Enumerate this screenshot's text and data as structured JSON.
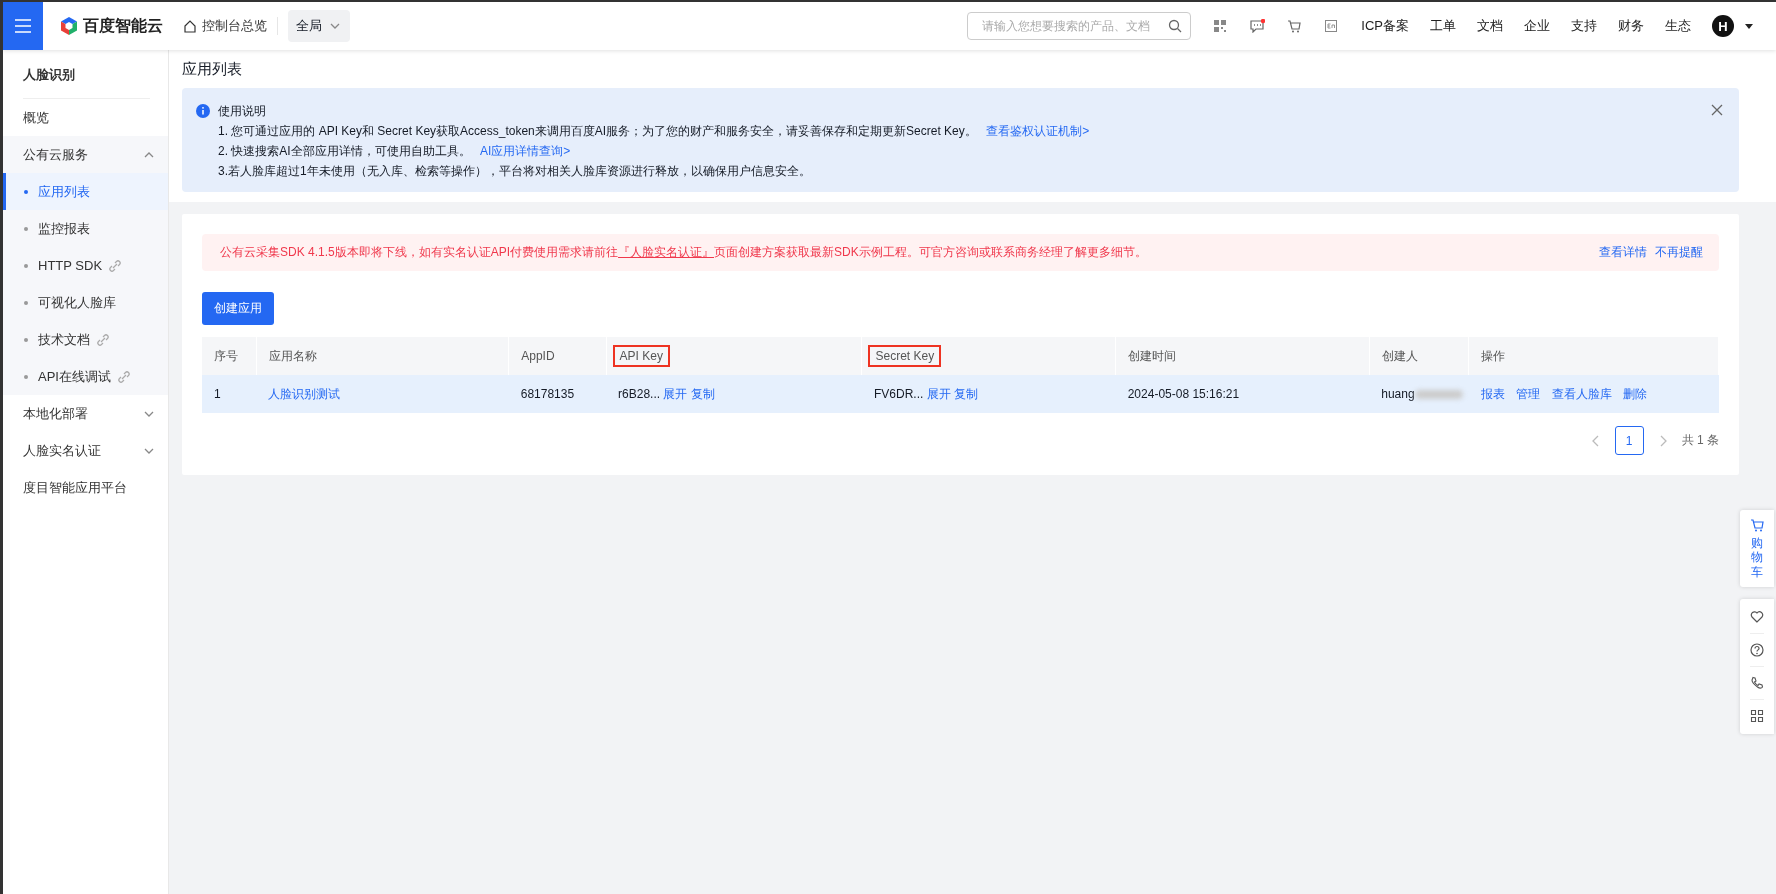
{
  "topbar": {
    "logo": "百度智能云",
    "home": "控制台总览",
    "region": "全局",
    "search": {
      "placeholder": "请输入您想要搜索的产品、文档"
    },
    "message_unread": true,
    "links": [
      "ICP备案",
      "工单",
      "文档",
      "企业",
      "支持",
      "财务",
      "生态"
    ],
    "avatar": "H"
  },
  "sidebar": {
    "title": "人脸识别",
    "items": [
      {
        "kind": "item",
        "label": "概览"
      },
      {
        "kind": "group",
        "label": "公有云服务",
        "expanded": true,
        "children": [
          {
            "label": "应用列表",
            "selected": true,
            "external": false
          },
          {
            "label": "监控报表",
            "selected": false,
            "external": false
          },
          {
            "label": "HTTP SDK",
            "selected": false,
            "external": true
          },
          {
            "label": "可视化人脸库",
            "selected": false,
            "external": false
          },
          {
            "label": "技术文档",
            "selected": false,
            "external": true
          },
          {
            "label": "API在线调试",
            "selected": false,
            "external": true
          }
        ]
      },
      {
        "kind": "group",
        "label": "本地化部署",
        "expanded": false
      },
      {
        "kind": "group",
        "label": "人脸实名认证",
        "expanded": false
      },
      {
        "kind": "item",
        "label": "度目智能应用平台"
      }
    ]
  },
  "page_title": "应用列表",
  "info": {
    "title": "使用说明",
    "lines": [
      {
        "text": "1. 您可通过应用的 API Key和 Secret Key获取Access_token来调用百度AI服务；为了您的财产和服务安全，请妥善保存和定期更新Secret Key。",
        "link": "查看鉴权认证机制>"
      },
      {
        "text": "2. 快速搜索AI全部应用详情，可使用自助工具。",
        "link": "AI应用详情查询>"
      },
      {
        "text": "3.若人脸库超过1年未使用（无入库、检索等操作），平台将对相关人脸库资源进行释放，以确保用户信息安全。"
      }
    ]
  },
  "notice": {
    "before": "公有云采集SDK 4.1.5版本即将下线，如有实名认证API付费使用需求请前往",
    "link": "『人脸实名认证』",
    "after": "页面创建方案获取最新SDK示例工程。可官方咨询或联系商务经理了解更多细节。",
    "actions": [
      "查看详情",
      "不再提醒"
    ]
  },
  "create_button": "创建应用",
  "table": {
    "columns": [
      {
        "label": "序号",
        "highlighted": false
      },
      {
        "label": "应用名称",
        "highlighted": false
      },
      {
        "label": "AppID",
        "highlighted": false
      },
      {
        "label": "API Key",
        "highlighted": true
      },
      {
        "label": "Secret Key",
        "highlighted": true
      },
      {
        "label": "创建时间",
        "highlighted": false
      },
      {
        "label": "创建人",
        "highlighted": false
      },
      {
        "label": "操作",
        "highlighted": false
      }
    ],
    "rows": [
      {
        "index": "1",
        "name": "人脸识别测试",
        "app_id": "68178135",
        "api_key": {
          "value": "r6B28...",
          "actions": [
            "展开",
            "复制"
          ]
        },
        "secret_key": {
          "value": "FV6DR...",
          "actions": [
            "展开",
            "复制"
          ]
        },
        "created": "2024-05-08 15:16:21",
        "creator": "huang",
        "creator_blurred": true,
        "actions": [
          "报表",
          "管理",
          "查看人脸库",
          "删除"
        ]
      }
    ]
  },
  "pagination": {
    "pages": [
      {
        "label": "1",
        "selected": true
      }
    ],
    "total": "共 1 条"
  },
  "float_bar": {
    "cart": "购物车"
  }
}
